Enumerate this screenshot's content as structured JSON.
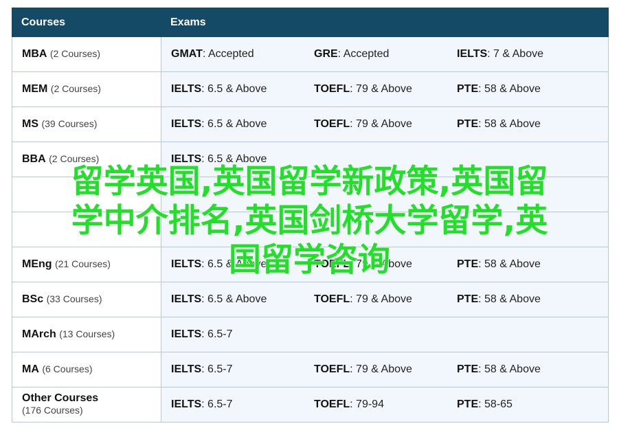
{
  "table": {
    "header": {
      "courses": "Courses",
      "exams": "Exams"
    },
    "rows": [
      {
        "name": "MBA",
        "count": "(2 Courses)",
        "exams": [
          {
            "name": "GMAT",
            "sep": ": ",
            "value": "Accepted"
          },
          {
            "name": "GRE",
            "sep": ": ",
            "value": "Accepted"
          },
          {
            "name": "IELTS",
            "sep": ": ",
            "value": "7 & Above"
          }
        ]
      },
      {
        "name": "MEM",
        "count": "(2 Courses)",
        "exams": [
          {
            "name": "IELTS",
            "sep": ": ",
            "value": "6.5 & Above"
          },
          {
            "name": "TOEFL",
            "sep": ": ",
            "value": "79 & Above"
          },
          {
            "name": "PTE",
            "sep": ": ",
            "value": "58 & Above"
          }
        ]
      },
      {
        "name": "MS",
        "count": "(39 Courses)",
        "exams": [
          {
            "name": "IELTS",
            "sep": ": ",
            "value": "6.5 & Above"
          },
          {
            "name": "TOEFL",
            "sep": ": ",
            "value": "79 & Above"
          },
          {
            "name": "PTE",
            "sep": ": ",
            "value": "58 & Above"
          }
        ]
      },
      {
        "name": "BBA",
        "count": "(2 Courses)",
        "exams": [
          {
            "name": "IELTS",
            "sep": ": ",
            "value": "6.5 & Above"
          },
          {
            "name": "",
            "sep": "",
            "value": ""
          },
          {
            "name": "",
            "sep": "",
            "value": ""
          }
        ]
      },
      {
        "name": "",
        "count": "",
        "exams": [
          {
            "name": "",
            "sep": "",
            "value": ""
          },
          {
            "name": "",
            "sep": "",
            "value": ""
          },
          {
            "name": "",
            "sep": "",
            "value": ""
          }
        ]
      },
      {
        "name": "",
        "count": "",
        "exams": [
          {
            "name": "",
            "sep": "",
            "value": ""
          },
          {
            "name": "",
            "sep": "",
            "value": ""
          },
          {
            "name": "",
            "sep": "",
            "value": ""
          }
        ]
      },
      {
        "name": "MEng",
        "count": "(21 Courses)",
        "exams": [
          {
            "name": "IELTS",
            "sep": ": ",
            "value": "6.5 & Above"
          },
          {
            "name": "TOEFL",
            "sep": ": ",
            "value": "79 & Above"
          },
          {
            "name": "PTE",
            "sep": ": ",
            "value": "58 & Above"
          }
        ]
      },
      {
        "name": "BSc",
        "count": "(33 Courses)",
        "exams": [
          {
            "name": "IELTS",
            "sep": ": ",
            "value": "6.5 & Above"
          },
          {
            "name": "TOEFL",
            "sep": ": ",
            "value": "79 & Above"
          },
          {
            "name": "PTE",
            "sep": ": ",
            "value": "58 & Above"
          }
        ]
      },
      {
        "name": "MArch",
        "count": "(13 Courses)",
        "exams": [
          {
            "name": "IELTS",
            "sep": ": ",
            "value": "6.5-7"
          },
          {
            "name": "",
            "sep": "",
            "value": ""
          },
          {
            "name": "",
            "sep": "",
            "value": ""
          }
        ]
      },
      {
        "name": "MA",
        "count": "(6 Courses)",
        "exams": [
          {
            "name": "IELTS",
            "sep": ": ",
            "value": "6.5-7"
          },
          {
            "name": "TOEFL",
            "sep": ": ",
            "value": "79 & Above"
          },
          {
            "name": "PTE",
            "sep": ": ",
            "value": "58 & Above"
          }
        ]
      },
      {
        "name": "Other Courses",
        "count": "(176 Courses)",
        "exams": [
          {
            "name": "IELTS",
            "sep": ": ",
            "value": "6.5-7"
          },
          {
            "name": "TOEFL",
            "sep": ": ",
            "value": "79-94"
          },
          {
            "name": "PTE",
            "sep": ": ",
            "value": "58-65"
          }
        ]
      }
    ]
  },
  "overlay": {
    "lines": [
      "留学英国,英国留学新政策,英国留",
      "学中介排名,英国剑桥大学留学,英",
      "国留学咨询"
    ]
  },
  "colors": {
    "header_bg": "#154a66",
    "row_bg": "#f2f7fd",
    "border": "#bac8d6",
    "overlay_text": "#22e02a"
  }
}
